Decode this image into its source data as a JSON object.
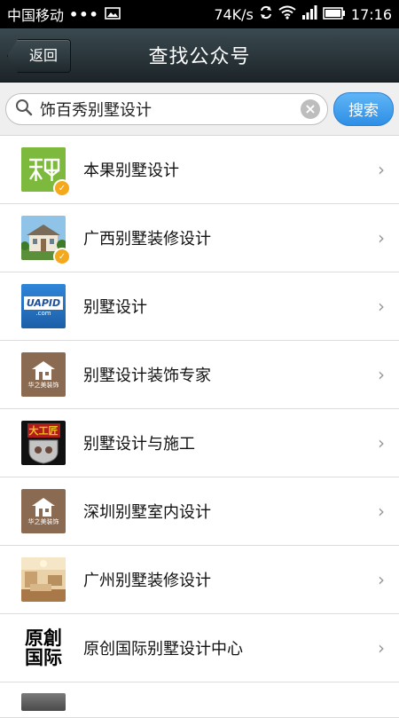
{
  "status": {
    "carrier": "中国移动",
    "dots": "•••",
    "speed": "74K/s",
    "time": "17:16"
  },
  "header": {
    "back_label": "返回",
    "title": "查找公众号"
  },
  "search": {
    "query": "饰百秀别墅设计",
    "button_label": "搜索"
  },
  "results": [
    {
      "name": "本果别墅设计",
      "verified": true,
      "logo": "benguo"
    },
    {
      "name": "广西别墅装修设计",
      "verified": true,
      "logo": "house-photo"
    },
    {
      "name": "别墅设计",
      "verified": false,
      "logo": "uapid"
    },
    {
      "name": "别墅设计装饰专家",
      "verified": false,
      "logo": "huazhimei"
    },
    {
      "name": "别墅设计与施工",
      "verified": false,
      "logo": "dagongjiang"
    },
    {
      "name": "深圳别墅室内设计",
      "verified": false,
      "logo": "huazhimei"
    },
    {
      "name": "广州别墅装修设计",
      "verified": false,
      "logo": "interior-photo"
    },
    {
      "name": "原创国际别墅设计中心",
      "verified": false,
      "logo": "yuanchuang"
    }
  ],
  "logo_text": {
    "uapid": "UAPID",
    "uapid_sub": ".com",
    "huazhimei": "华之美装饰",
    "dagongjiang": "大工匠",
    "yuanchuang_1": "原創",
    "yuanchuang_2": "国际"
  },
  "colors": {
    "titlebar": "#1c2428",
    "accent_blue": "#2f8fe6",
    "verified_orange": "#f4a81b"
  }
}
